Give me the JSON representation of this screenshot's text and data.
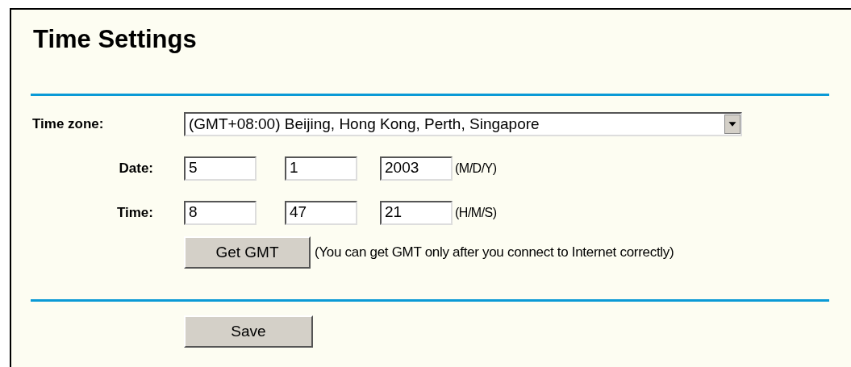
{
  "title": "Time Settings",
  "time_zone": {
    "label": "Time zone:",
    "value": "(GMT+08:00) Beijing, Hong Kong, Perth, Singapore"
  },
  "date": {
    "label": "Date:",
    "fields": [
      "5",
      "1",
      "2003"
    ],
    "hint": "(M/D/Y)"
  },
  "time": {
    "label": "Time:",
    "fields": [
      "8",
      "47",
      "21"
    ],
    "hint": "(H/M/S)"
  },
  "get_gmt": {
    "button": "Get GMT",
    "note": "(You can get GMT only after you connect to Internet correctly)"
  },
  "save_button": "Save"
}
